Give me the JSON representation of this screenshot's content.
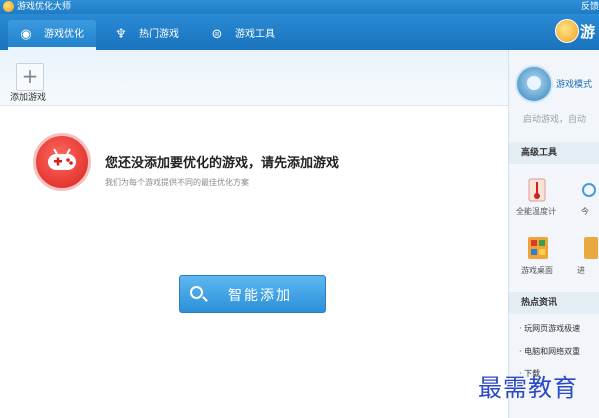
{
  "app": {
    "title": "游戏优化大师",
    "feedback": "反馈"
  },
  "nav": {
    "tabs": [
      {
        "label": "游戏优化",
        "icon": "gamepad-icon",
        "active": true
      },
      {
        "label": "热门游戏",
        "icon": "trophy-icon",
        "active": false
      },
      {
        "label": "游戏工具",
        "icon": "toolbox-icon",
        "active": false
      }
    ],
    "brand": "游"
  },
  "toolbar": {
    "add_game": "添加游戏"
  },
  "main": {
    "empty_title": "您还没添加要优化的游戏，请先添加游戏",
    "empty_subtitle": "我们为每个游戏提供不同的最佳优化方案",
    "smart_add": "智能添加"
  },
  "sidebar": {
    "mode_label": "游戏模式",
    "mode_sub": "启动游戏，自动",
    "advanced_tools": "高级工具",
    "tools": [
      {
        "label": "全能温度计",
        "icon": "thermometer-icon"
      },
      {
        "label": "今",
        "icon": "refresh-icon"
      },
      {
        "label": "游戏桌面",
        "icon": "desktop-icon"
      },
      {
        "label": "进",
        "icon": "process-icon"
      }
    ],
    "hot_news": "热点资讯",
    "news": [
      "· 玩网页游戏极速",
      "· 电脑和网络双重",
      "· 下载"
    ]
  },
  "watermark": "最需教育",
  "colors": {
    "primary": "#1e7cc4",
    "accent": "#e0332c"
  }
}
